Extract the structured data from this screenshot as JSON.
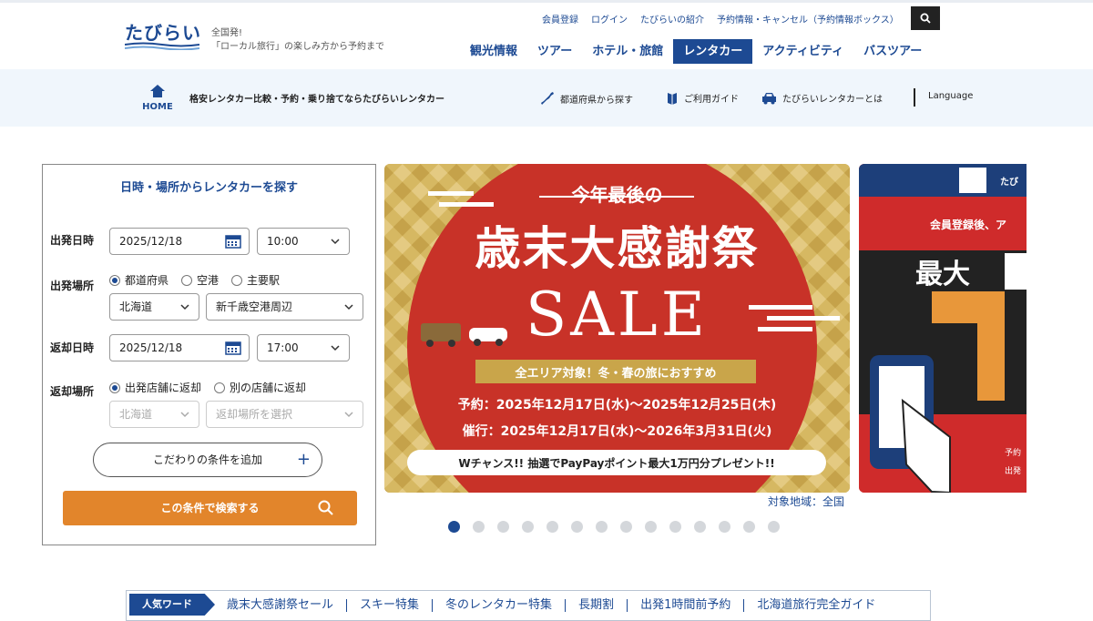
{
  "header": {
    "logo_text": "たびらい",
    "tagline_line1": "全国発!",
    "tagline_line2": "「ローカル旅行」の楽しみ方から予約まで",
    "util_links": [
      "会員登録",
      "ログイン",
      "たびらいの紹介",
      "予約情報・キャンセル（予約情報ボックス）"
    ],
    "main_nav": [
      "観光情報",
      "ツアー",
      "ホテル・旅館",
      "レンタカー",
      "アクティビティ",
      "バスツアー"
    ],
    "active_nav": "レンタカー"
  },
  "subbar": {
    "home_label": "HOME",
    "title": "格安レンタカー比較・予約・乗り捨てならたびらいレンタカー",
    "links": [
      "都道府県から探す",
      "ご利用ガイド",
      "たびらいレンタカーとは"
    ],
    "language": "Language"
  },
  "search_panel": {
    "title": "日時・場所からレンタカーを探す",
    "depart_date_label": "出発日時",
    "depart_date": "2025/12/18",
    "depart_time": "10:00",
    "depart_place_label": "出発場所",
    "depart_place_options": [
      "都道府県",
      "空港",
      "主要駅"
    ],
    "depart_pref": "北海道",
    "depart_area": "新千歳空港周辺",
    "return_date_label": "返却日時",
    "return_date": "2025/12/18",
    "return_time": "17:00",
    "return_place_label": "返却場所",
    "return_place_options": [
      "出発店舗に返却",
      "別の店舗に返却"
    ],
    "return_pref": "北海道",
    "return_area": "返却場所を選択",
    "conditions_button": "こだわりの条件を追加",
    "search_button": "この条件で検索する"
  },
  "banner": {
    "headline_small": "今年最後の",
    "headline": "歳末大感謝祭",
    "sale": "SALE",
    "ribbon": "全エリア対象！冬・春の旅におすすめ",
    "booking": "予約：2025年12月17日(水)～2025年12月25日(木)",
    "travel": "催行：2025年12月17日(水)～2026年3月31日(火)",
    "chance": "Wチャンス!! 抽選でPayPayポイント最大1万円分プレゼント!!",
    "caption": "対象地域：全国"
  },
  "banner2": {
    "line1": "会員登録後、ア",
    "big": "最大",
    "number": "1",
    "small1": "予約",
    "small2": "出発",
    "brand": "たび"
  },
  "carousel": {
    "count": 14,
    "active_index": 0
  },
  "popular": {
    "tag": "人気ワード",
    "words": [
      "歳末大感謝祭セール",
      "スキー特集",
      "冬のレンタカー特集",
      "長期割",
      "出発1時間前予約",
      "北海道旅行完全ガイド"
    ]
  },
  "colors": {
    "brand": "#1d4a93",
    "orange": "#e2852b",
    "banner_red": "#c83228",
    "gold": "#c9a54a"
  }
}
